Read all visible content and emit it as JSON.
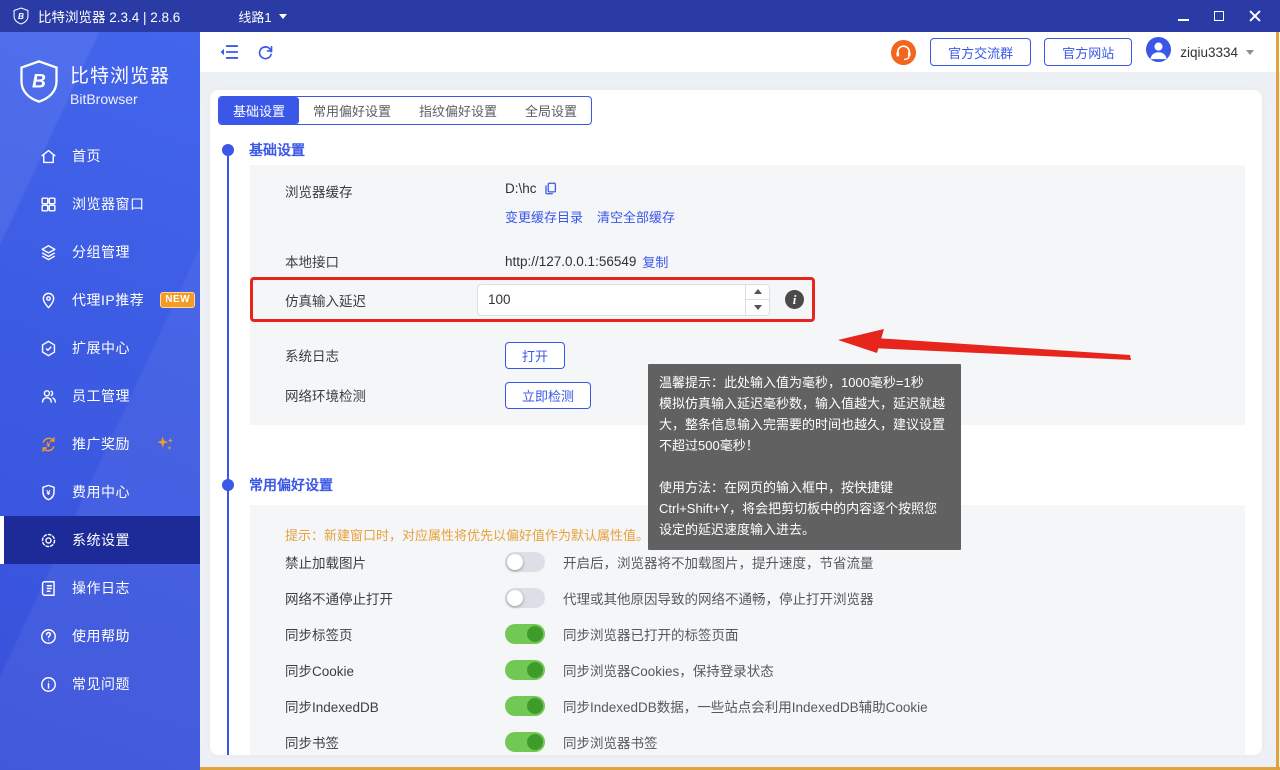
{
  "window": {
    "title": "比特浏览器 2.3.4 | 2.8.6",
    "line_selector": "线路1"
  },
  "sidebar": {
    "logo_title": "比特浏览器",
    "logo_subtitle": "BitBrowser",
    "items": [
      {
        "label": "首页",
        "icon": "home-icon"
      },
      {
        "label": "浏览器窗口",
        "icon": "browser-windows-icon"
      },
      {
        "label": "分组管理",
        "icon": "group-layers-icon"
      },
      {
        "label": "代理IP推荐",
        "icon": "location-pin-icon",
        "badge": "NEW"
      },
      {
        "label": "扩展中心",
        "icon": "extension-icon"
      },
      {
        "label": "员工管理",
        "icon": "staff-icon"
      },
      {
        "label": "推广奖励",
        "icon": "promo-reward-icon"
      },
      {
        "label": "费用中心",
        "icon": "billing-shield-icon"
      },
      {
        "label": "系统设置",
        "icon": "gear-icon",
        "active": true
      },
      {
        "label": "操作日志",
        "icon": "operation-log-icon"
      },
      {
        "label": "使用帮助",
        "icon": "help-icon"
      },
      {
        "label": "常见问题",
        "icon": "faq-icon"
      }
    ]
  },
  "header": {
    "group_button": "官方交流群",
    "site_button": "官方网站",
    "username": "ziqiu3334"
  },
  "tabs": [
    {
      "label": "基础设置",
      "active": true
    },
    {
      "label": "常用偏好设置"
    },
    {
      "label": "指纹偏好设置"
    },
    {
      "label": "全局设置"
    }
  ],
  "basic_section": {
    "title": "基础设置",
    "cache": {
      "label": "浏览器缓存",
      "value": "D:\\hc",
      "link1": "变更缓存目录",
      "link2": "清空全部缓存"
    },
    "local_api": {
      "label": "本地接口",
      "value": "http://127.0.0.1:56549",
      "copy_link": "复制"
    },
    "input_delay": {
      "label": "仿真输入延迟",
      "value": "100"
    },
    "system_log": {
      "label": "系统日志",
      "button": "打开"
    },
    "network_check": {
      "label": "网络环境检测",
      "button": "立即检测"
    }
  },
  "tooltip": {
    "line1": "温馨提示：此处输入值为毫秒，1000毫秒=1秒",
    "line2": "模拟仿真输入延迟毫秒数，输入值越大，延迟就越大，整条信息输入完需要的时间也越久，建议设置不超过500毫秒！",
    "line3": "使用方法：在网页的输入框中，按快捷键Ctrl+Shift+Y，将会把剪切板中的内容逐个按照您设定的延迟速度输入进去。"
  },
  "prefs_section": {
    "title": "常用偏好设置",
    "tip": "提示：新建窗口时，对应属性将优先以偏好值作为默认属性值。",
    "toggles": [
      {
        "label": "禁止加载图片",
        "on": false,
        "desc": "开启后，浏览器将不加载图片，提升速度，节省流量"
      },
      {
        "label": "网络不通停止打开",
        "on": false,
        "desc": "代理或其他原因导致的网络不通畅，停止打开浏览器"
      },
      {
        "label": "同步标签页",
        "on": true,
        "desc": "同步浏览器已打开的标签页面"
      },
      {
        "label": "同步Cookie",
        "on": true,
        "desc": "同步浏览器Cookies，保持登录状态"
      },
      {
        "label": "同步IndexedDB",
        "on": true,
        "desc": "同步IndexedDB数据，一些站点会利用IndexedDB辅助Cookie"
      },
      {
        "label": "同步书签",
        "on": true,
        "desc": "同步浏览器书签"
      }
    ]
  },
  "colors": {
    "accent": "#3A57E8",
    "titlebar": "#2B3BA5",
    "sidebar": "#3C5BE3",
    "sidebar_active": "#1D2B99",
    "toggle_on": "#72C854",
    "warning_orange": "#E6A23C",
    "annotation_red": "#E8251D",
    "tooltip_bg": "#5C5C5C",
    "frame_orange": "#DFA33C"
  }
}
